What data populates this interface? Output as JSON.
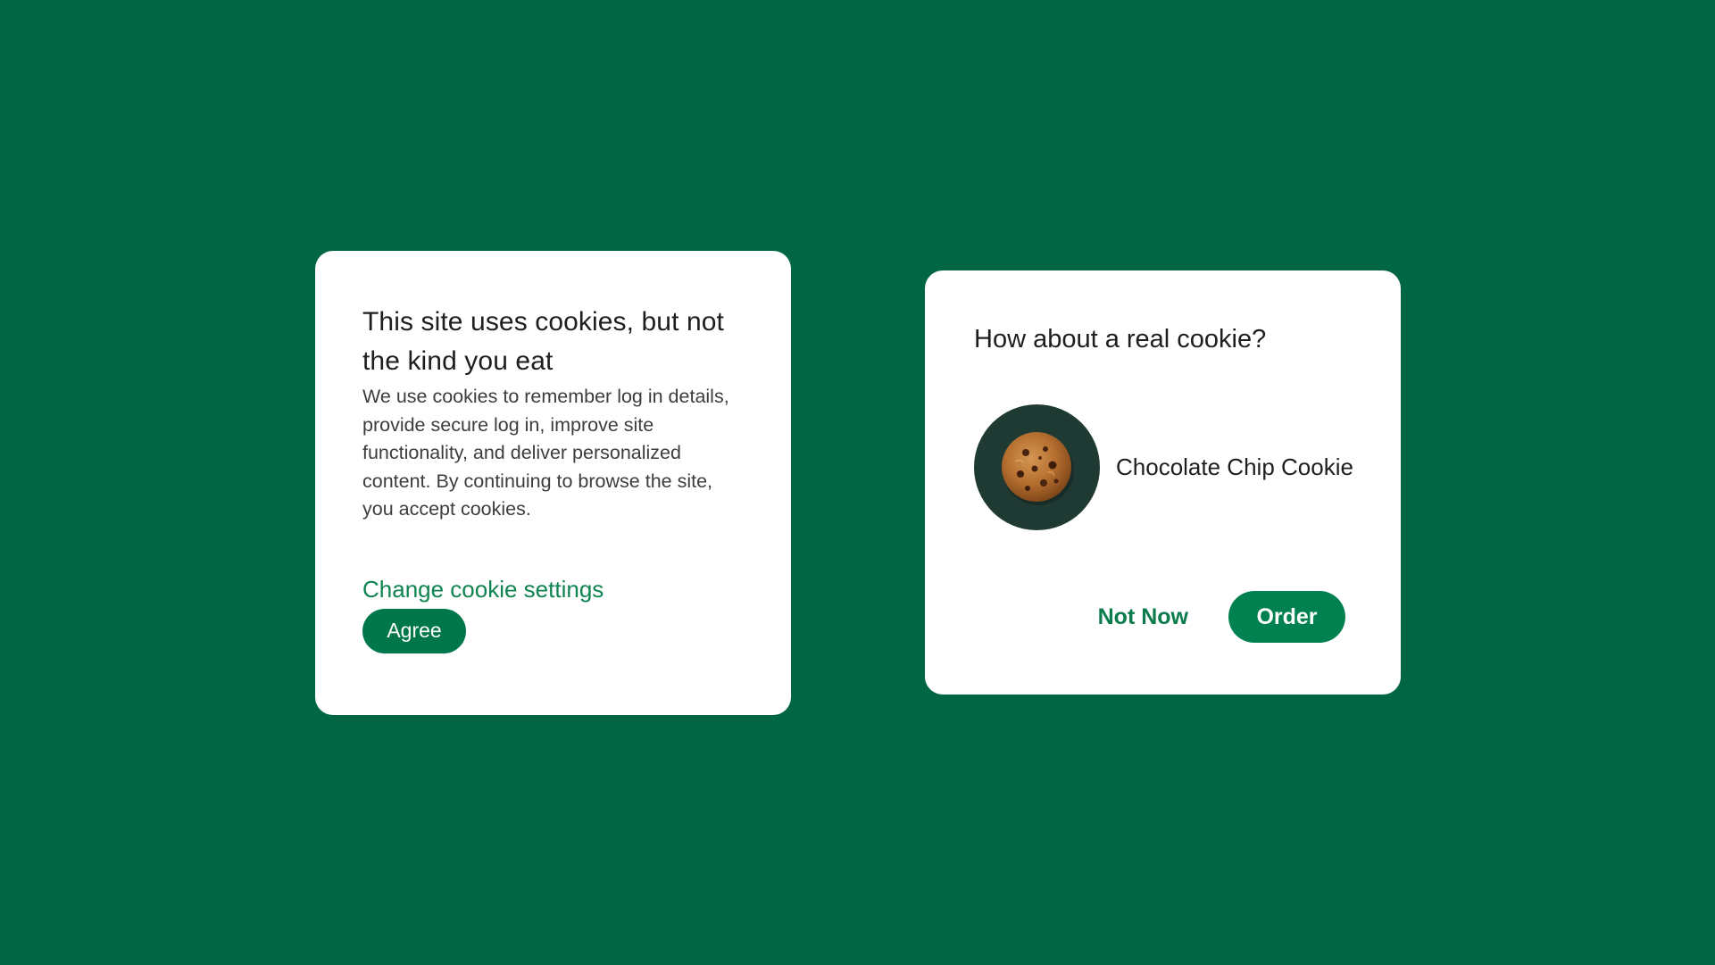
{
  "consent_dialog": {
    "title": "This site uses cookies, but not the kind you eat",
    "body": "We use cookies to remember log in details, provide secure log in, improve site functionality, and deliver personalized content. By continuing to browse the site, you accept cookies.",
    "settings_link": "Change cookie settings",
    "agree_label": "Agree"
  },
  "order_dialog": {
    "title": "How about a real cookie?",
    "product": {
      "name": "Chocolate Chip Cookie",
      "image_icon": "cookie-image"
    },
    "not_now_label": "Not Now",
    "order_label": "Order"
  },
  "colors": {
    "background": "#006643",
    "accent": "#00774B",
    "link": "#0F8451",
    "thumb_bg": "#1F3933"
  }
}
